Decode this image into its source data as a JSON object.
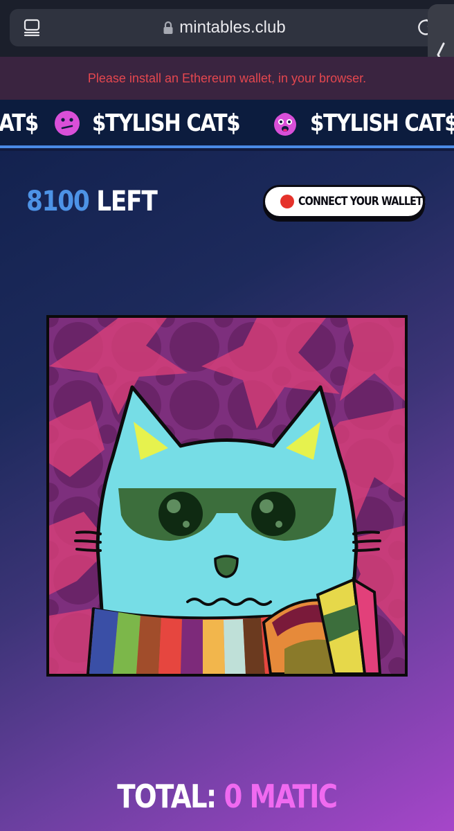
{
  "browser": {
    "url": "mintables.club",
    "icons": {
      "reader": "reader-mode-icon",
      "lock": "lock-icon",
      "reload": "reload-icon",
      "side_handle": "chevron-left-icon"
    }
  },
  "banner": {
    "message": "Please install an Ethereum wallet, in your browser.",
    "color": "#e4474f"
  },
  "marquee": {
    "items": [
      "CAT$",
      "$TYLISH CAT$",
      "$TYLISH CAT$"
    ],
    "emoji_icons": [
      "confused-face-icon",
      "hungry-face-icon",
      "worried-face-icon"
    ]
  },
  "mint": {
    "remaining": "8100",
    "remaining_label": "LEFT",
    "connect_button": "CONNECT YOUR WALLET!",
    "total_label": "TOTAL:",
    "total_value": "0 MATIC"
  },
  "colors": {
    "accent_blue": "#4d93e6",
    "accent_pink": "#f06af0",
    "status_red": "#e5322b"
  },
  "nft_image": "stylish-cat-with-sunglasses-and-rainbow-scarf"
}
